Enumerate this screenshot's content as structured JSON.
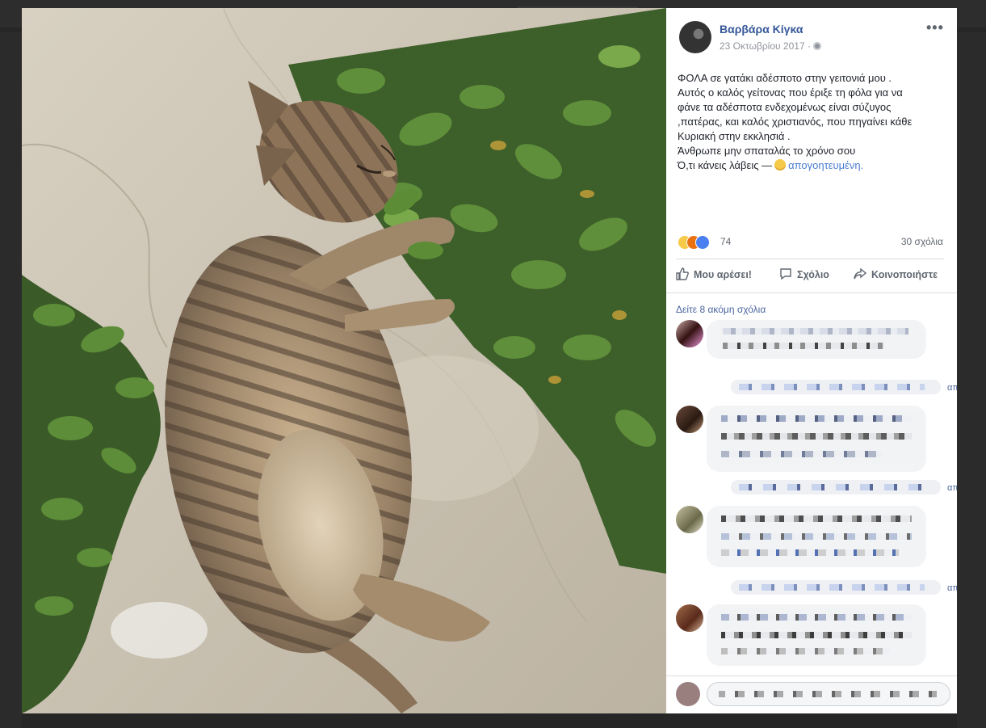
{
  "post": {
    "author": "Βαρβάρα Κίγκα",
    "date": "23 Οκτωβρίου 2017 ·",
    "lines": [
      "ΦΟΛΑ σε γατάκι αδέσποτο στην γειτονιά μου .",
      "Αυτός ο καλός γείτονας που έριξε τη φόλα για να",
      "φάνε τα αδέσποτα ενδεχομένως είναι σύζυγος",
      ",πατέρας, και καλός χριστιανός, που πηγαίνει κάθε",
      "Κυριακή στην εκκλησιά .",
      "Άνθρωπε μην σπαταλάς το χρόνο σου"
    ],
    "last_line": "Ό,τι κάνεις λάβεις —",
    "feeling": "απογοητευμένη.",
    "reaction_count": "74",
    "comment_count": "30 σχόλια",
    "colors": {
      "link": "#365899",
      "accent": "#4b66a0",
      "muted": "#90949c"
    }
  },
  "actions": {
    "like": "Μου αρέσει!",
    "comment": "Σχόλιο",
    "share": "Κοινοποιήστε"
  },
  "comments": {
    "more": "Δείτε 8 ακόμη σχόλια",
    "cut": "απ"
  },
  "icons": [
    "options-icon",
    "globe-icon",
    "like-icon",
    "comment-icon",
    "share-icon",
    "sad-reaction-icon",
    "angry-reaction-icon",
    "like-reaction-icon",
    "feeling-emoji-icon"
  ]
}
